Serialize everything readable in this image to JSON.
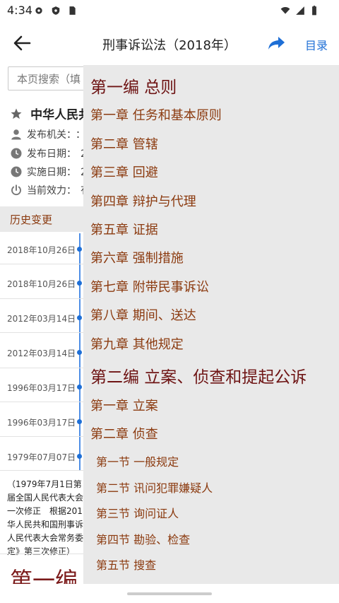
{
  "status_bar": {
    "time": "4:34",
    "icons": [
      "gear-icon",
      "shield-icon",
      "sd-card-icon",
      "wifi-icon",
      "signal-icon",
      "battery-icon"
    ]
  },
  "app_bar": {
    "title": "刑事诉讼法（2018年）",
    "toc_label": "目录",
    "accent_color": "#1e6fd6"
  },
  "search": {
    "placeholder": "本页搜索（填"
  },
  "law": {
    "title": "中华人民共",
    "meta": [
      {
        "label": "发布机关：",
        "value": "：",
        "icon": "person-icon"
      },
      {
        "label": "发布日期：",
        "value": "2",
        "icon": "clock-icon"
      },
      {
        "label": "实施日期：",
        "value": "2",
        "icon": "clock-icon"
      },
      {
        "label": "当前效力：",
        "value": "有",
        "icon": "power-icon"
      }
    ]
  },
  "history": {
    "label": "历史变更",
    "dates": [
      "2018年10月26日",
      "2018年10月26日",
      "2012年03月14日",
      "2012年03月14日",
      "1996年03月17日",
      "1996年03月17日",
      "1979年07月07日"
    ]
  },
  "note": {
    "lines": [
      "（1979年7月1日第",
      "届全国人民代表大会",
      "一次修正　根据201",
      "华人民共和国刑事诉",
      "人民代表大会常务委",
      "定》第三次修正）"
    ]
  },
  "body_heading": "第一编",
  "toc": {
    "items": [
      {
        "level": "part",
        "label": "第一编 总则"
      },
      {
        "level": "chapter",
        "label": "第一章 任务和基本原则"
      },
      {
        "level": "chapter",
        "label": "第二章 管辖"
      },
      {
        "level": "chapter",
        "label": "第三章 回避"
      },
      {
        "level": "chapter",
        "label": "第四章 辩护与代理"
      },
      {
        "level": "chapter",
        "label": "第五章 证据"
      },
      {
        "level": "chapter",
        "label": "第六章 强制措施"
      },
      {
        "level": "chapter",
        "label": "第七章 附带民事诉讼"
      },
      {
        "level": "chapter",
        "label": "第八章 期间、送达"
      },
      {
        "level": "chapter",
        "label": "第九章 其他规定"
      },
      {
        "level": "part",
        "label": "第二编 立案、侦查和提起公诉"
      },
      {
        "level": "chapter",
        "label": "第一章 立案"
      },
      {
        "level": "chapter",
        "label": "第二章 侦查"
      },
      {
        "level": "section",
        "label": "第一节 一般规定"
      },
      {
        "level": "section",
        "label": "第二节 讯问犯罪嫌疑人"
      },
      {
        "level": "section",
        "label": "第三节 询问证人"
      },
      {
        "level": "section",
        "label": "第四节 勘验、检查"
      },
      {
        "level": "section",
        "label": "第五节 搜查"
      }
    ]
  }
}
